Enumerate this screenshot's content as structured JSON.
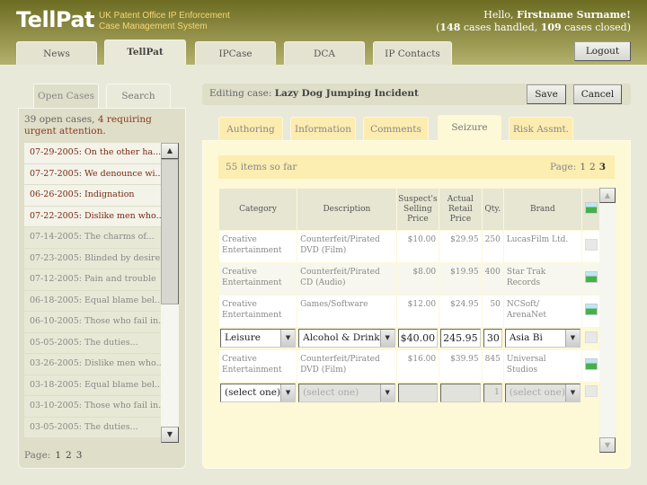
{
  "header": {
    "logo": "TellPat",
    "subtitle_line1": "UK Patent Office IP Enforcement",
    "subtitle_line2": "Case Management System",
    "greeting_prefix": "Hello, ",
    "user_name": "Firstname Surname!",
    "cases_handled": "148",
    "cases_handled_label": " cases handled, ",
    "cases_closed": "109",
    "cases_closed_label": " cases closed)",
    "open_paren": "(",
    "logout": "Logout"
  },
  "nav": {
    "tabs": [
      "News",
      "TellPat",
      "IPCase",
      "DCA",
      "IP Contacts"
    ],
    "active": "TellPat"
  },
  "left": {
    "tabs": [
      "Open Cases",
      "Search"
    ],
    "active": "Open Cases",
    "open_count": "39 open cases, ",
    "urgent_text": "4 requiring urgent attention.",
    "cases": [
      {
        "label": "07-29-2005: On the other ha...",
        "urgent": true
      },
      {
        "label": "07-27-2005: We denounce wi...",
        "urgent": true
      },
      {
        "label": "06-26-2005: Indignation",
        "urgent": true
      },
      {
        "label": "07-22-2005: Dislike men who...",
        "urgent": true
      },
      {
        "label": "07-14-2005: The charms of...",
        "urgent": false
      },
      {
        "label": "07-23-2005: Blinded by desire",
        "urgent": false
      },
      {
        "label": "07-12-2005: Pain and trouble",
        "urgent": false
      },
      {
        "label": "06-18-2005: Equal blame bel...",
        "urgent": false
      },
      {
        "label": "06-10-2005: Those who fail in...",
        "urgent": false
      },
      {
        "label": "05-05-2005: The duties...",
        "urgent": false
      },
      {
        "label": "03-26-2005: Dislike men who...",
        "urgent": false
      },
      {
        "label": "03-18-2005: Equal blame bel...",
        "urgent": false
      },
      {
        "label": "03-10-2005: Those who fail in...",
        "urgent": false
      },
      {
        "label": "03-05-2005: The duties...",
        "urgent": false
      }
    ],
    "page_label": "Page:",
    "pages": [
      "1",
      "2",
      "3"
    ]
  },
  "edit": {
    "prefix": "Editing case: ",
    "case_name": "Lazy Dog Jumping Incident",
    "save": "Save",
    "cancel": "Cancel"
  },
  "subtabs": {
    "tabs": [
      "Authoring",
      "Information",
      "Comments",
      "Seizure",
      "Risk Assmt."
    ],
    "active": "Seizure"
  },
  "seizure": {
    "count_text": "55 items so far",
    "page_label": "Page:",
    "pages": [
      "1",
      "2",
      "3"
    ],
    "current_page": "3",
    "columns": [
      "Category",
      "Description",
      "Suspect's Selling Price",
      "Actual Retail Price",
      "Qty.",
      "Brand"
    ],
    "rows": [
      {
        "category": "Creative Entertainment",
        "description": "Counterfeit/Pirated DVD (Film)",
        "selling": "$10.00",
        "retail": "$29.95",
        "qty": "250",
        "brand": "LucasFilm Ltd.",
        "has_image": false
      },
      {
        "category": "Creative Entertainment",
        "description": "Counterfeit/Pirated CD (Audio)",
        "selling": "$8.00",
        "retail": "$19.95",
        "qty": "400",
        "brand": "Star Trak Records",
        "has_image": true
      },
      {
        "category": "Creative Entertainment",
        "description": "Games/Software",
        "selling": "$12.00",
        "retail": "$24.95",
        "qty": "50",
        "brand": "NCSoft/ ArenaNet",
        "has_image": true
      }
    ],
    "edit_row": {
      "category": "Leisure",
      "description": "Alcohol & Drink",
      "selling": "$40.00",
      "retail": "245.95",
      "qty": "30",
      "brand": "Asia Bi"
    },
    "rows_after": [
      {
        "category": "Creative Entertainment",
        "description": "Counterfeit/Pirated DVD (Film)",
        "selling": "$16.00",
        "retail": "$39.95",
        "qty": "845",
        "brand": "Universal Studios",
        "has_image": true
      }
    ],
    "new_row": {
      "category": "(select one)",
      "description": "(select one)",
      "qty": "1",
      "brand": "(select one)"
    }
  },
  "icons": {
    "image": "image-icon",
    "scroll_up": "arrow-up-icon",
    "scroll_down": "arrow-down-icon"
  },
  "colors": {
    "header": "#6d6c22",
    "subtitle": "#f3d772",
    "urgent": "#7a2a10",
    "panel": "#fdf8d6",
    "strip": "#fcedb0"
  }
}
